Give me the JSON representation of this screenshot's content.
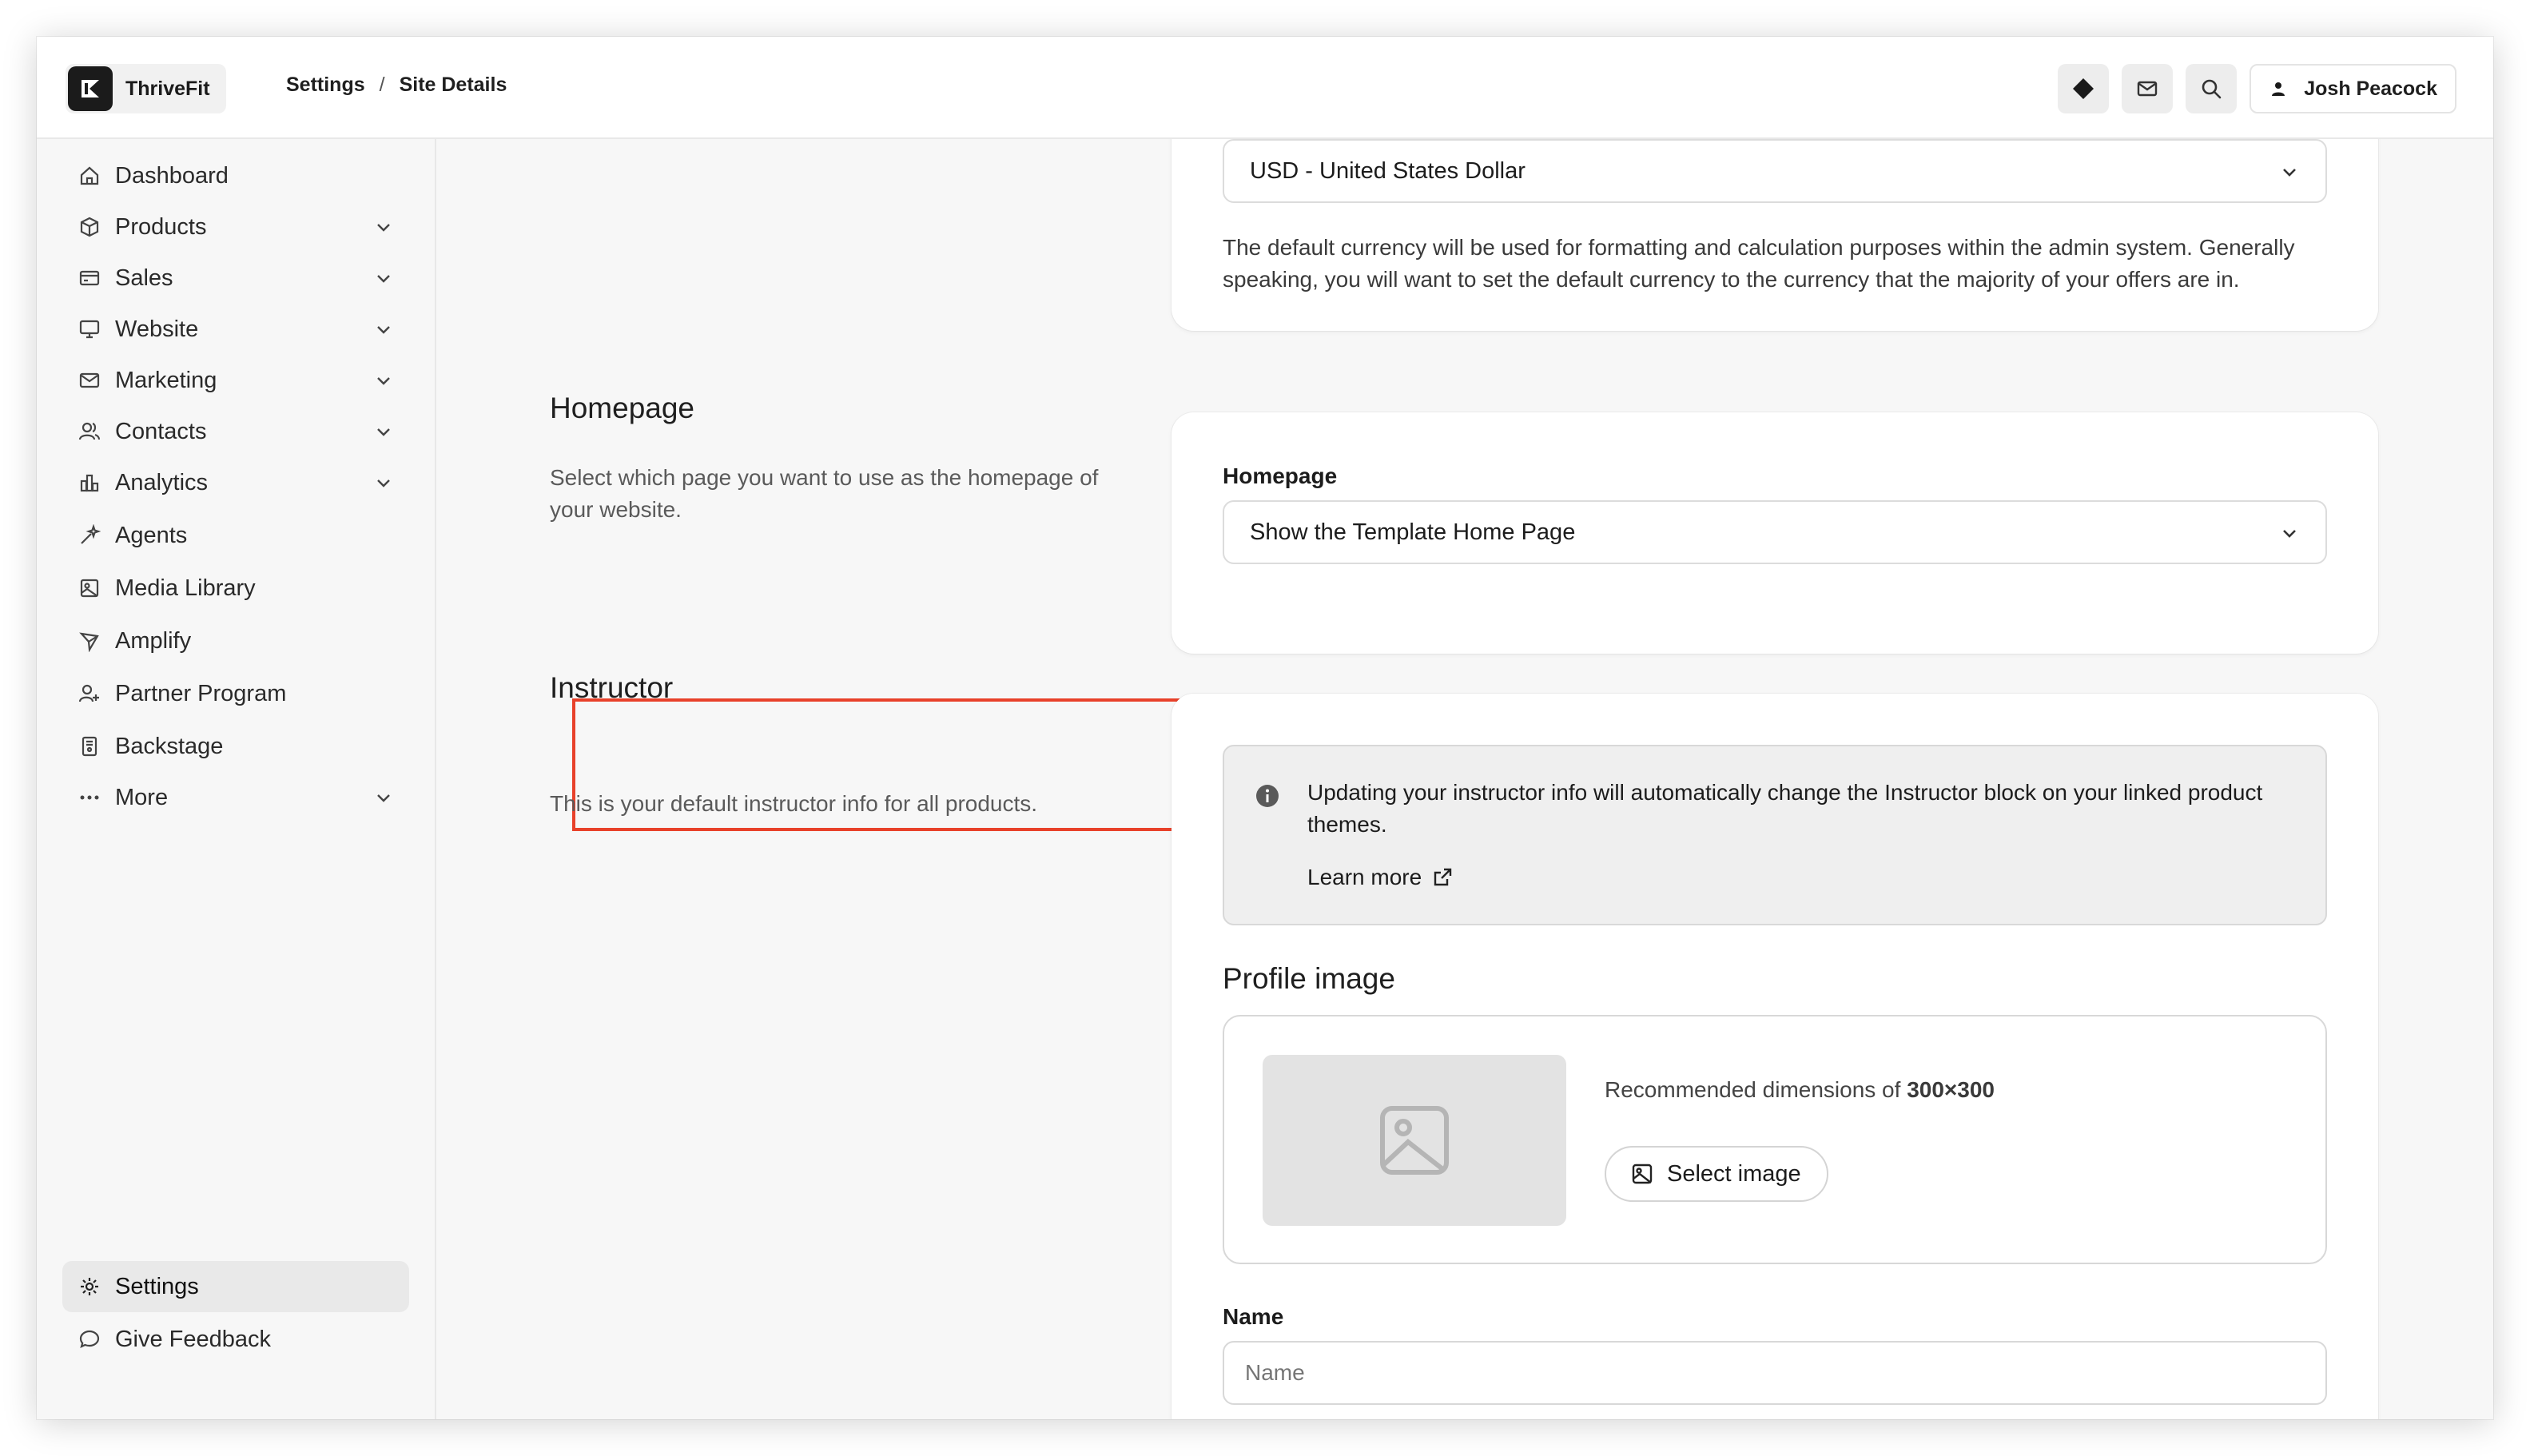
{
  "app": {
    "name": "ThriveFit"
  },
  "breadcrumb": {
    "parent": "Settings",
    "separator": "/",
    "current": "Site Details"
  },
  "user": {
    "name": "Josh Peacock"
  },
  "top_actions": [
    "diamond-icon",
    "mail-icon",
    "search-icon"
  ],
  "sidebar": {
    "items": [
      {
        "label": "Dashboard",
        "icon": "home-icon",
        "expandable": false
      },
      {
        "label": "Products",
        "icon": "box-icon",
        "expandable": true
      },
      {
        "label": "Sales",
        "icon": "card-icon",
        "expandable": true
      },
      {
        "label": "Website",
        "icon": "monitor-icon",
        "expandable": true
      },
      {
        "label": "Marketing",
        "icon": "mail-icon",
        "expandable": true
      },
      {
        "label": "Contacts",
        "icon": "users-icon",
        "expandable": true
      },
      {
        "label": "Analytics",
        "icon": "bar-chart-icon",
        "expandable": true
      },
      {
        "label": "Agents",
        "icon": "sparkle-icon",
        "expandable": false
      },
      {
        "label": "Media Library",
        "icon": "image-icon",
        "expandable": false
      },
      {
        "label": "Amplify",
        "icon": "send-icon",
        "expandable": false
      },
      {
        "label": "Partner Program",
        "icon": "user-plus-icon",
        "expandable": false
      },
      {
        "label": "Backstage",
        "icon": "book-icon",
        "expandable": false
      },
      {
        "label": "More",
        "icon": "dots-icon",
        "expandable": true
      }
    ],
    "footer": [
      {
        "label": "Settings",
        "icon": "gear-icon",
        "active": true
      },
      {
        "label": "Give Feedback",
        "icon": "chat-icon",
        "active": false
      }
    ]
  },
  "currency": {
    "selected": "USD - United States Dollar",
    "help": "The default currency will be used for formatting and calculation purposes within the admin system. Generally speaking, you will want to set the default currency to the currency that the majority of your offers are in."
  },
  "homepage_section": {
    "title": "Homepage",
    "description": "Select which page you want to use as the homepage of your website.",
    "field_label": "Homepage",
    "selected": "Show the Template Home Page"
  },
  "instructor_section": {
    "title": "Instructor",
    "description": "This is your default instructor info for all products.",
    "info_text": "Updating your instructor info will automatically change the Instructor block on your linked product themes.",
    "learn_more": "Learn more",
    "profile_image_heading": "Profile image",
    "recommended_prefix": "Recommended dimensions of",
    "recommended_dims": "300×300",
    "select_image_label": "Select image",
    "name_label": "Name",
    "name_placeholder": "Name"
  },
  "colors": {
    "highlight": "#e8412a",
    "background": "#f7f7f7",
    "card": "#ffffff"
  }
}
